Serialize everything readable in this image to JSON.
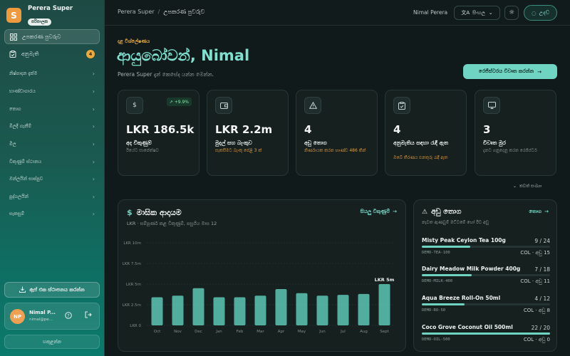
{
  "brand": {
    "logo_letter": "S",
    "name": "Perera Super",
    "badge": "පරිපාලක"
  },
  "sidebar": {
    "active_item": "උපකරණ පුවරුව",
    "alerts_item": {
      "label": "අනුමැති",
      "count": "4"
    },
    "groups": [
      "නිෂ්පාදන දැක්ම",
      "භාණ්ඩාගාරය",
      "තොග",
      "මිලදී ගැනීම්",
      "මිල",
      "විකුණුම් ස්ථානය",
      "ඔන්ලයින් සාප්පුව",
      "පුද්ගලයින්",
      "සැකසුම්"
    ],
    "install_label": "ඇප් එක ස්ථාපනය කරන්න",
    "user_initials": "NP",
    "user_name": "Nimal P...",
    "user_email": "nimal@pe...",
    "collapse_label": "හකුළන්න"
  },
  "topbar": {
    "breadcrumb_root": "Perera Super",
    "breadcrumb_current": "උපකරණ පුවරුව",
    "user_name": "Nimal Perera",
    "language": "සිංහල",
    "help_label": "උදව්"
  },
  "header": {
    "eyebrow": "දළ විශ්ලේෂණය",
    "greeting": "ආයුබෝවන්, Nimal",
    "subtitle": "Perera Super දැන් කෙසේද යන්න මෙන්න.",
    "report_button": "රෙජිස්ටරය විවෘත කරන්න"
  },
  "stats": [
    {
      "icon": "dollar-icon",
      "glyph": "$",
      "value": "LKR 186.5k",
      "label": "අද විකුණුම්",
      "desc": "ඊයේට සාපේක්ෂව",
      "trend": "+9.9%"
    },
    {
      "icon": "wallet-icon",
      "glyph": "▭",
      "value": "LKR 2.2m",
      "label": "මුදල් සහ බැංකුව",
      "desc": "සැකසීමට බැංකු පේළි 3 ක්"
    },
    {
      "icon": "alert-triangle-icon",
      "glyph": "⚠",
      "value": "4",
      "label": "අඩු තොග",
      "desc": "නිර්ණායක කරන භාණ්ඩ 486 කින්"
    },
    {
      "icon": "clipboard-icon",
      "glyph": "▤",
      "value": "4",
      "label": "අනුමැතිය සඳහා රැඳී ඇත",
      "desc": "ඔබේ තීරණය එනතුරු රැඳී ඇත"
    },
    {
      "icon": "monitor-icon",
      "glyph": "▢",
      "value": "3",
      "label": "විවෘත මුර",
      "desc": "දැනට ගනුදෙනු කරන රෙජිස්ටර්"
    }
  ],
  "more_link": "තවත් සංඛ්‍යා",
  "revenue": {
    "title": "මාසික ආදායම",
    "subtitle": "LKR · සම්පූර්ණ කළ විකුණුම්, පසුගිය මාස 12",
    "link": "සියලු විකුණුම්"
  },
  "chart_data": {
    "type": "bar",
    "categories": [
      "Oct",
      "Nov",
      "Dec",
      "Jan",
      "Feb",
      "Mar",
      "Apr",
      "May",
      "Jun",
      "Jul",
      "Aug",
      "Sept"
    ],
    "values": [
      3.4,
      3.6,
      4.5,
      3.4,
      3.4,
      3.6,
      4.4,
      3.9,
      3.6,
      3.7,
      3.8,
      5.0
    ],
    "yticks": [
      "LKR 0",
      "LKR 2.5m",
      "LKR 5m",
      "LKR 7.5m",
      "LKR 10m"
    ],
    "ylim": [
      0,
      10
    ],
    "highlight_label": "LKR 5m",
    "color": "#5cc8b6"
  },
  "low_stock": {
    "title": "අඩු තොග",
    "link": "තොග",
    "subtitle": "නැවත ඇණවුම් මට්ටමේ හෝ ඊට අඩු",
    "items": [
      {
        "name": "Misty Peak Ceylon Tea 100g",
        "qty": "9 / 24",
        "sku": "DEMO-TEA-100",
        "loc": "COL · අඩු 15",
        "fraction": 0.375
      },
      {
        "name": "Dairy Meadow Milk Powder 400g",
        "qty": "7 / 18",
        "sku": "DEMO-MILK-400",
        "loc": "COL · අඩු 11",
        "fraction": 0.389
      },
      {
        "name": "Aqua Breeze Roll-On 50ml",
        "qty": "4 / 12",
        "sku": "DEMO-RO-50",
        "loc": "COL · අඩු 8",
        "fraction": 0.333
      },
      {
        "name": "Coco Grove Coconut Oil 500ml",
        "qty": "22 / 20",
        "sku": "DEMO-OIL-500",
        "loc": "COL · අඩු 0",
        "fraction": 1.0
      }
    ]
  }
}
